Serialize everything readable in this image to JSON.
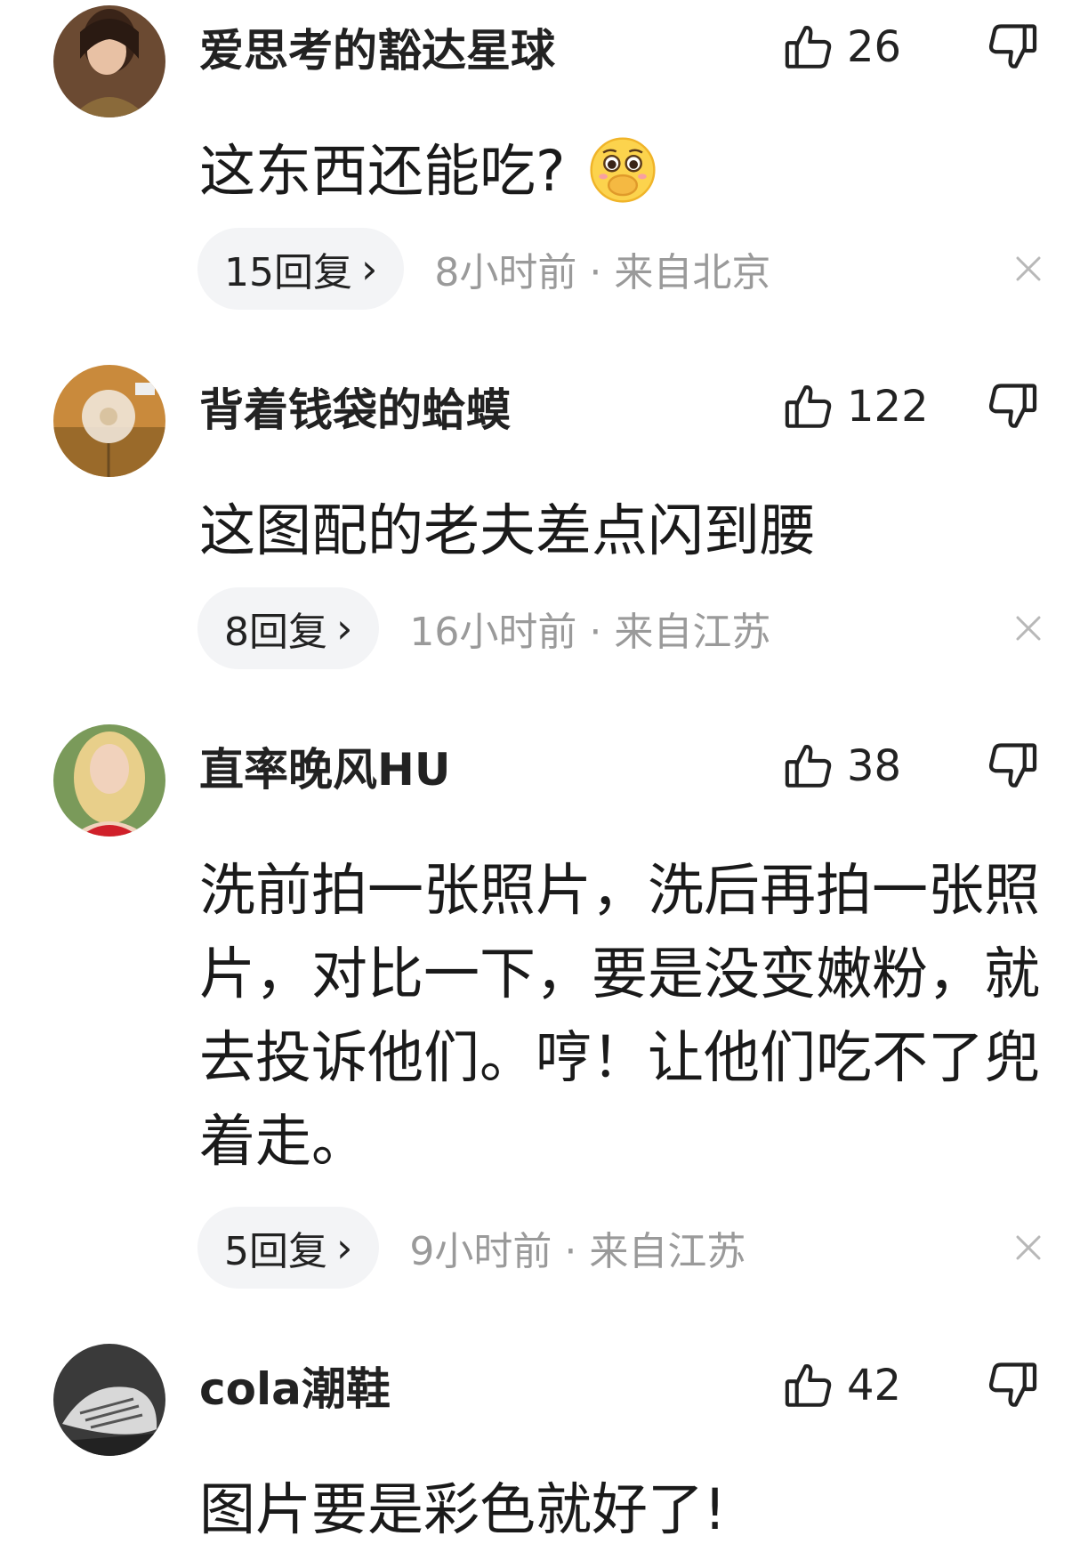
{
  "comments": [
    {
      "username": "爱思考的豁达星球",
      "likes": "26",
      "content": "这东西还能吃?",
      "has_emoji": true,
      "replies": "15回复",
      "meta": "8小时前 · 来自北京"
    },
    {
      "username": "背着钱袋的蛤蟆",
      "likes": "122",
      "content": "这图配的老夫差点闪到腰",
      "replies": "8回复",
      "meta": "16小时前 · 来自江苏"
    },
    {
      "username": "直率晚风HU",
      "likes": "38",
      "content": "洗前拍一张照片，洗后再拍一张照片，对比一下，要是没变嫩粉，就去投诉他们。哼！让他们吃不了兜着走。",
      "replies": "5回复",
      "meta": "9小时前 · 来自江苏"
    },
    {
      "username": "cola潮鞋",
      "likes": "42",
      "content": "图片要是彩色就好了!"
    }
  ],
  "icons": {
    "like": "thumbs-up-icon",
    "dislike": "thumbs-down-icon",
    "close": "close-icon",
    "chevron": "chevron-right-icon",
    "emoji": "pleading-face-emoji-icon"
  },
  "colors": {
    "text_primary": "#1a1a1a",
    "text_secondary": "#9a9a9a",
    "pill_background": "#f3f4f6"
  }
}
